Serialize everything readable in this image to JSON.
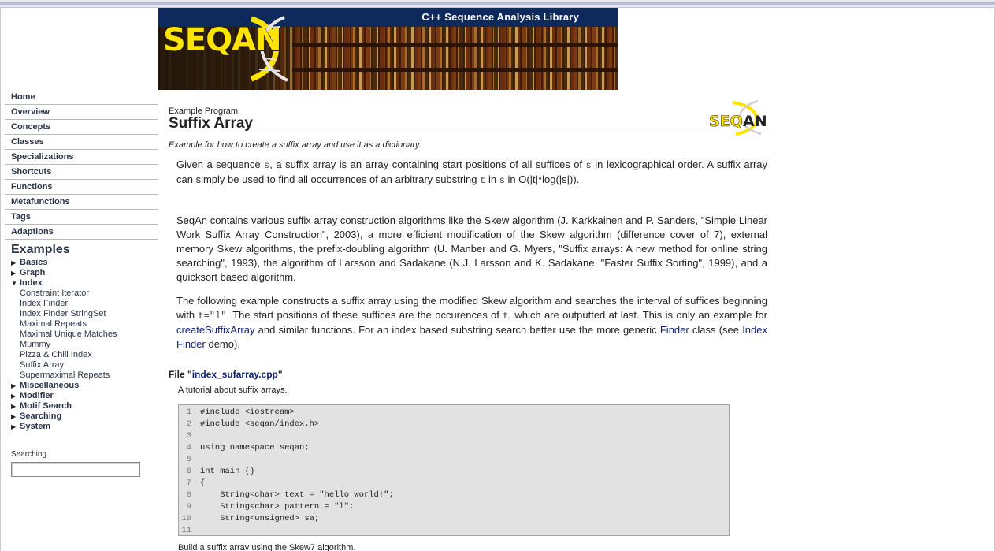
{
  "header": {
    "banner_title": "C++ Sequence Analysis Library",
    "logo_text_a": "SEQ",
    "logo_text_b": "AN"
  },
  "sidebar": {
    "nav": [
      "Home",
      "Overview",
      "Concepts",
      "Classes",
      "Specializations",
      "Shortcuts",
      "Functions",
      "Metafunctions",
      "Tags",
      "Adaptions"
    ],
    "examples_heading": "Examples",
    "tree_before": [
      "Basics",
      "Graph"
    ],
    "expanded": "Index",
    "index_children": [
      "Constraint Iterator",
      "Index Finder",
      "Index Finder StringSet",
      "Maximal Repeats",
      "Maximal Unique Matches",
      "Mummy",
      "Pizza & Chili Index",
      "Suffix Array",
      "Supermaximal Repeats"
    ],
    "tree_after": [
      "Miscellaneous",
      "Modifier",
      "Motif Search",
      "Searching",
      "System"
    ],
    "search_label": "Searching",
    "search_value": ""
  },
  "main": {
    "kicker": "Example Program",
    "title": "Suffix Array",
    "small_logo_a": "SEQ",
    "small_logo_b": "AN",
    "summary": "Example for how to create a suffix array and use it as a dictionary.",
    "p1": {
      "t1": "Given a sequence ",
      "c1": "s",
      "t2": ", a suffix array is an array containing start positions of all suffices of ",
      "c2": "s",
      "t3": " in lexicographical order. A suffix array can simply be used to find all occurrences of an arbitrary substring ",
      "c3": "t",
      "t4": " in ",
      "c4": "s",
      "t5": " in O(|t|*log(|s|))."
    },
    "p2": "SeqAn contains various suffix array construction algorithms like the Skew algorithm (J. Karkkainen and P. Sanders, \"Simple Linear Work Suffix Array Construction\", 2003), a more efficient modification of the Skew algorithm (difference cover of 7), external memory Skew algorithms, the prefix-doubling algorithm (U. Manber and G. Myers, \"Suffix arrays: A new method for online string searching\", 1993), the algorithm of Larsson and Sadakane (N.J. Larsson and K. Sadakane, \"Faster Suffix Sorting\", 1999), and a quicksort based algorithm.",
    "p3": {
      "t1": "The following example constructs a suffix array using the modified Skew algorithm and searches the interval of suffices beginning with ",
      "c1": "t=\"l\"",
      "t2": ". The start positions of these suffices are the occurences of ",
      "c2": "t",
      "t3": ", which are outputted at last. This is only an example for ",
      "l1": "createSuffixArray",
      "t4": " and similar functions. For an index based substring search better use the more generic ",
      "l2": "Finder",
      "t5": " class (see ",
      "l3": "Index Finder",
      "t6": " demo)."
    },
    "file_prefix": "File \"",
    "file_name": "index_sufarray.cpp",
    "file_suffix": "\"",
    "file_desc": "A tutorial about suffix arrays.",
    "code": [
      {
        "n": "1",
        "t": "#include <iostream>"
      },
      {
        "n": "2",
        "t": "#include <seqan/index.h>"
      },
      {
        "n": "3",
        "t": ""
      },
      {
        "n": "4",
        "t": "using namespace seqan;"
      },
      {
        "n": "5",
        "t": ""
      },
      {
        "n": "6",
        "t": "int main ()"
      },
      {
        "n": "7",
        "t": "{"
      },
      {
        "n": "8",
        "t": "    String<char> text = \"hello world!\";"
      },
      {
        "n": "9",
        "t": "    String<char> pattern = \"l\";"
      },
      {
        "n": "10",
        "t": "    String<unsigned> sa;"
      },
      {
        "n": "11",
        "t": ""
      }
    ],
    "after_code": "Build a suffix array using the Skew7 algorithm."
  }
}
